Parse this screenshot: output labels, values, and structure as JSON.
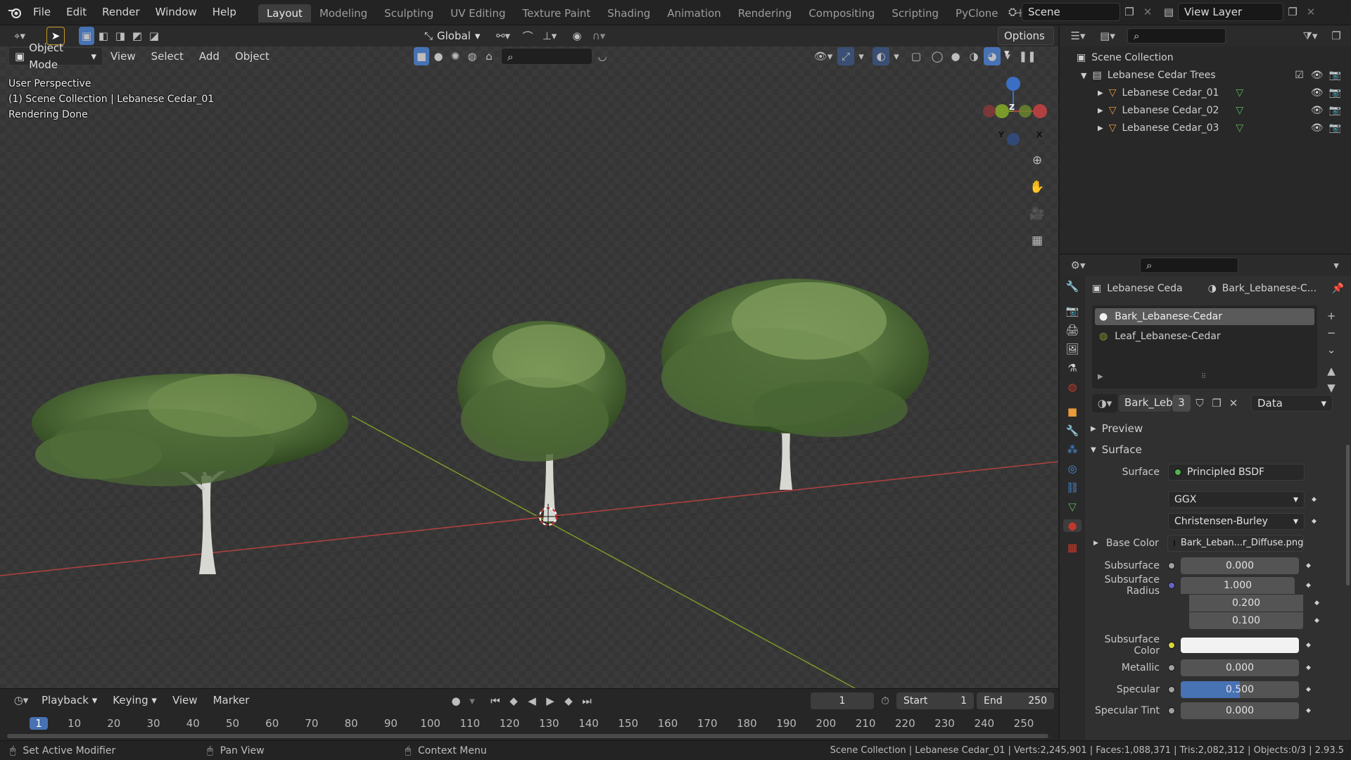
{
  "menu": {
    "file": "File",
    "edit": "Edit",
    "render": "Render",
    "window": "Window",
    "help": "Help"
  },
  "workspaces": [
    "Layout",
    "Modeling",
    "Sculpting",
    "UV Editing",
    "Texture Paint",
    "Shading",
    "Animation",
    "Rendering",
    "Compositing",
    "Scripting",
    "PyClone"
  ],
  "scene": {
    "name": "Scene",
    "view_layer": "View Layer"
  },
  "viewport": {
    "mode": "Object Mode",
    "menus": [
      "View",
      "Select",
      "Add",
      "Object"
    ],
    "orientation": "Global",
    "options": "Options",
    "overlay_lines": [
      "User Perspective",
      "(1) Scene Collection | Lebanese Cedar_01",
      "Rendering Done"
    ],
    "gizmo": {
      "z": "Z",
      "y": "Y",
      "x": "X"
    }
  },
  "outliner": {
    "root": "Scene Collection",
    "collection": "Lebanese Cedar Trees",
    "items": [
      "Lebanese Cedar_01",
      "Lebanese Cedar_02",
      "Lebanese Cedar_03"
    ]
  },
  "properties": {
    "object_name": "Lebanese Ceda",
    "material_name": "Bark_Lebanese-C...",
    "slots": [
      "Bark_Lebanese-Cedar",
      "Leaf_Lebanese-Cedar"
    ],
    "material_short": "Bark_Leb...",
    "users": "3",
    "link": "Data",
    "panels": {
      "preview": "Preview",
      "surface": "Surface"
    },
    "surface_label": "Surface",
    "surface_value": "Principled BSDF",
    "distribution": "GGX",
    "subsurface_method": "Christensen-Burley",
    "base_color_label": "Base Color",
    "base_color_value": "Bark_Leban...r_Diffuse.png",
    "subsurface_label": "Subsurface",
    "subsurface_value": "0.000",
    "subsurface_radius_label": "Subsurface Radius",
    "subsurface_radius": [
      "1.000",
      "0.200",
      "0.100"
    ],
    "subsurface_color_label": "Subsurface Color",
    "metallic_label": "Metallic",
    "metallic_value": "0.000",
    "specular_label": "Specular",
    "specular_value": "0.500",
    "specular_fraction": 0.5,
    "specular_tint_label": "Specular Tint",
    "specular_tint_value": "0.000"
  },
  "timeline": {
    "menus": [
      "Playback",
      "Keying",
      "View",
      "Marker"
    ],
    "current_frame": "1",
    "start_label": "Start",
    "start": "1",
    "end_label": "End",
    "end": "250",
    "ticks": [
      "1",
      "10",
      "20",
      "30",
      "40",
      "50",
      "60",
      "70",
      "80",
      "90",
      "100",
      "110",
      "120",
      "130",
      "140",
      "150",
      "160",
      "170",
      "180",
      "190",
      "200",
      "210",
      "220",
      "230",
      "240",
      "250"
    ]
  },
  "statusbar": {
    "left": "Set Active Modifier",
    "middle": "Pan View",
    "right": "Context Menu",
    "stats": "Scene Collection | Lebanese Cedar_01 | Verts:2,245,901 | Faces:1,088,371 | Tris:2,082,312 | Objects:0/3 | 2.93.5"
  },
  "colors": {
    "accent": "#4772b3",
    "active_tab": "#3d3d3d",
    "x_axis": "#b34040",
    "y_axis": "#7a9a2a",
    "z_axis": "#3a6fc4"
  }
}
